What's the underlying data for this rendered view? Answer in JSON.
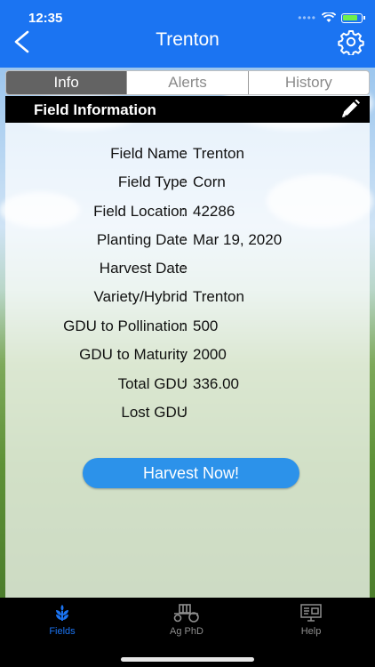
{
  "status": {
    "time": "12:35"
  },
  "nav": {
    "title": "Trenton"
  },
  "segments": [
    {
      "label": "Info",
      "active": true
    },
    {
      "label": "Alerts",
      "active": false
    },
    {
      "label": "History",
      "active": false
    }
  ],
  "panel": {
    "title": "Field Information"
  },
  "fields": [
    {
      "label": "Field Name",
      "value": "Trenton"
    },
    {
      "label": "Field Type",
      "value": "Corn"
    },
    {
      "label": "Field Location",
      "value": "42286"
    },
    {
      "label": "Planting Date",
      "value": "Mar 19, 2020"
    },
    {
      "label": "Harvest Date",
      "value": ""
    },
    {
      "label": "Variety/Hybrid",
      "value": "Trenton"
    },
    {
      "label": "GDU to Pollination",
      "value": "500"
    },
    {
      "label": "GDU to Maturity",
      "value": "2000"
    },
    {
      "label": "Total GDU",
      "value": "336.00"
    },
    {
      "label": "Lost GDU",
      "value": ""
    }
  ],
  "separator": ":",
  "harvest_button": "Harvest Now!",
  "tabbar": [
    {
      "label": "Fields",
      "icon": "wheat-icon",
      "active": true
    },
    {
      "label": "Ag PhD",
      "icon": "tractor-icon",
      "active": false
    },
    {
      "label": "Help",
      "icon": "presentation-board-icon",
      "active": false
    }
  ],
  "colors": {
    "accent": "#1b74f2",
    "button": "#2c92ea",
    "segment_active": "#636363"
  }
}
